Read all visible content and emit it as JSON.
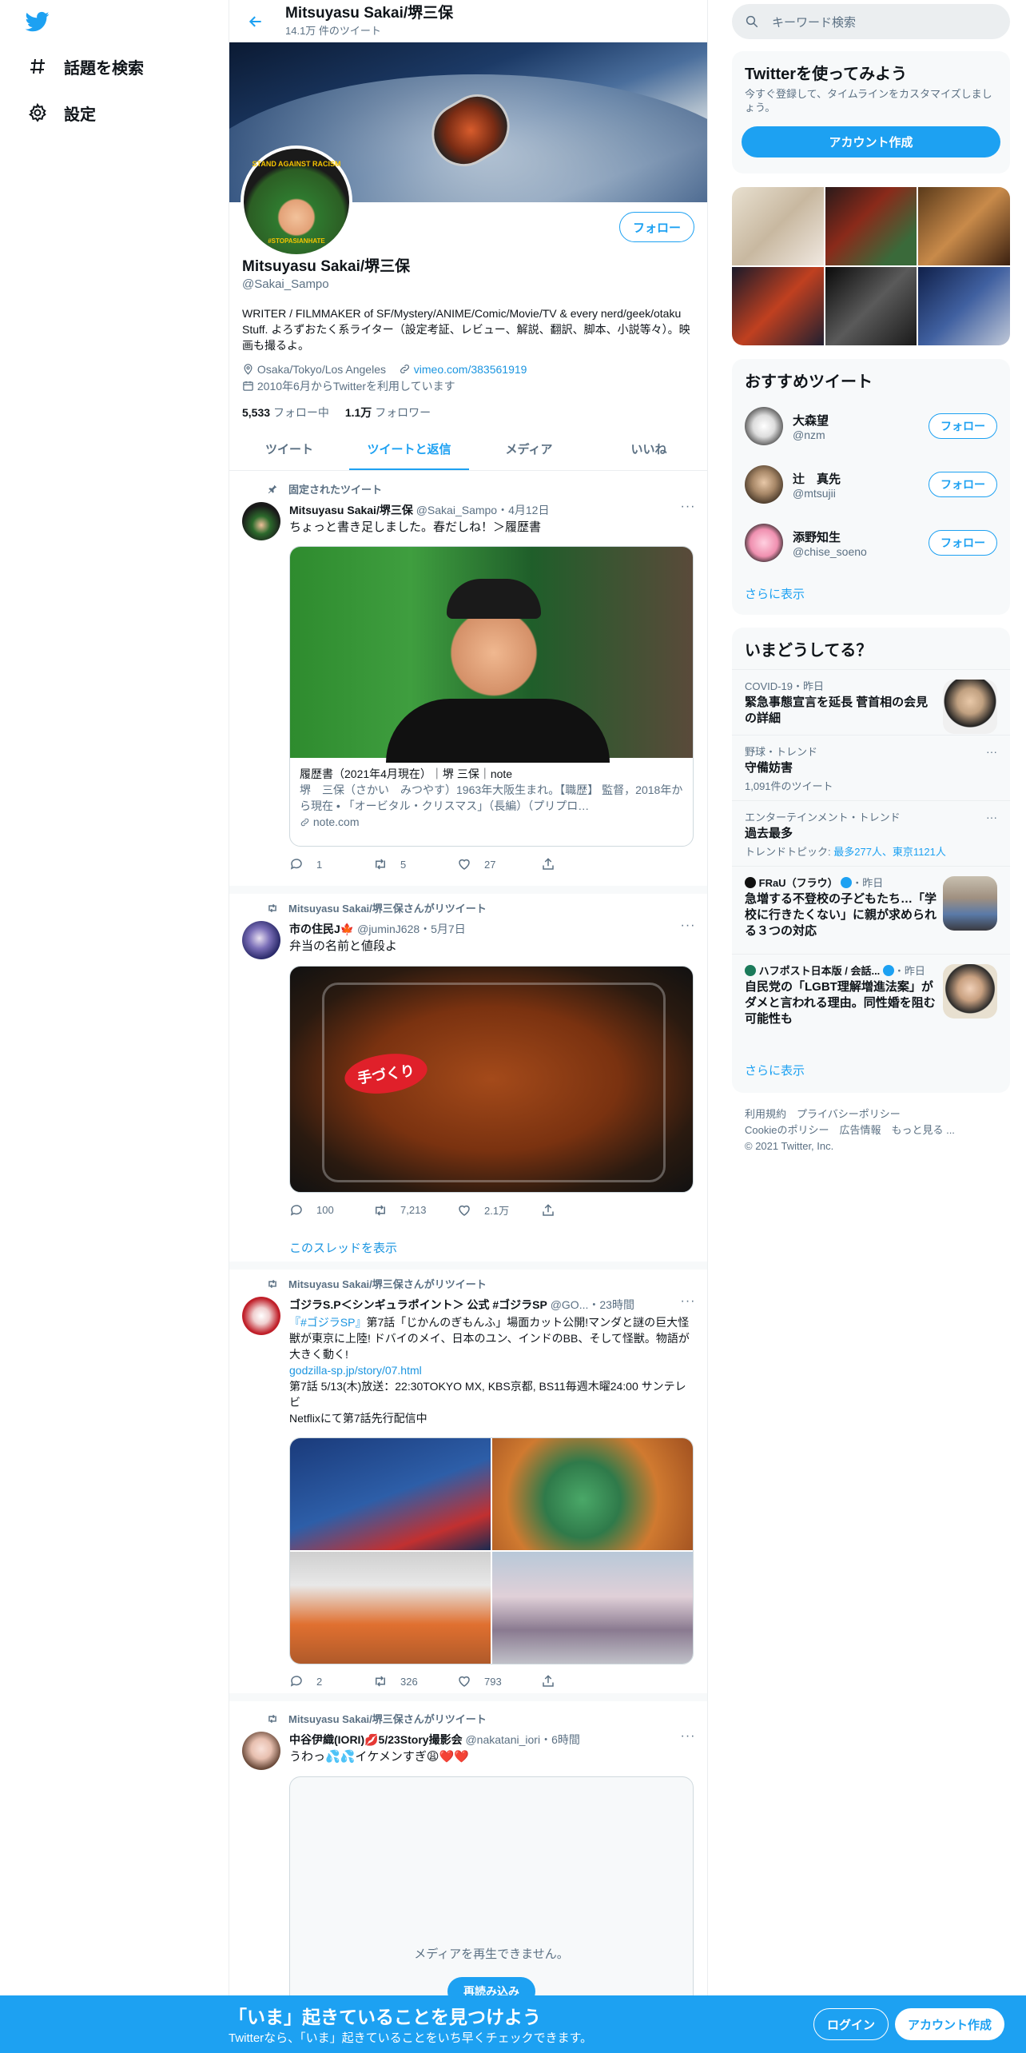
{
  "nav": {
    "explore_label": "話題を検索",
    "settings_label": "設定"
  },
  "header": {
    "name": "Mitsuyasu Sakai/堺三保",
    "tweet_count": "14.1万 件のツイート"
  },
  "profile": {
    "avatar_text_top": "STAND AGAINST RACISM",
    "avatar_text_bottom": "#STOPASIANHATE",
    "follow_label": "フォロー",
    "name": "Mitsuyasu Sakai/堺三保",
    "handle": "@Sakai_Sampo",
    "bio": "WRITER / FILMMAKER of SF/Mystery/ANIME/Comic/Movie/TV & every nerd/geek/otaku Stuff. よろずおたく系ライター（設定考証、レビュー、解説、翻訳、脚本、小説等々）。映画も撮るよ。",
    "location": "Osaka/Tokyo/Los Angeles",
    "url": "vimeo.com/383561919",
    "joined": "2010年6月からTwitterを利用しています",
    "following_count": "5,533",
    "following_label": "フォロー中",
    "followers_count": "1.1万",
    "followers_label": "フォロワー"
  },
  "tabs": [
    "ツイート",
    "ツイートと返信",
    "メディア",
    "いいね"
  ],
  "active_tab": 1,
  "tweets": [
    {
      "context": "固定されたツイート",
      "author": "Mitsuyasu Sakai/堺三保",
      "handle": "@Sakai_Sampo",
      "time": "・4月12日",
      "text": "ちょっと書き足しました。春だしね！＞履歴書",
      "card_title": "履歴書（2021年4月現在）｜堺 三保｜note",
      "card_desc": "堺　三保（さかい　みつやす）1963年大阪生まれ。【職歴】 監督，2018年から現在 • 「オービタル・クリスマス」（長編）（プリプロ…",
      "card_domain": "note.com",
      "replies": "1",
      "retweets": "5",
      "likes": "27"
    },
    {
      "context": "Mitsuyasu Sakai/堺三保さんがリツイート",
      "author": "市の住民J🍁",
      "handle": "@juminJ628",
      "time": "・5月7日",
      "text": "弁当の名前と値段よ",
      "media_label": "手づくり",
      "replies": "100",
      "retweets": "7,213",
      "likes": "2.1万",
      "thread_link": "このスレッドを表示"
    },
    {
      "context": "Mitsuyasu Sakai/堺三保さんがリツイート",
      "author": "ゴジラS.P＜シンギュラポイント＞ 公式 #ゴジラSP",
      "handle": "@GO...",
      "time": "・23時間",
      "hashtag": "『#ゴジラSP』",
      "text": "第7話「じかんのぎもんふ」場面カット公開!マンダと謎の巨大怪獣が東京に上陸! ドバイのメイ、日本のユン、インドのBB、そして怪獣。物語が大きく動く!",
      "link": "godzilla-sp.jp/story/07.html",
      "text2": "第7話 5/13(木)放送：22:30TOKYO MX, KBS京都, BS11毎週木曜24:00 サンテレビ",
      "text3": "Netflixにて第7話先行配信中",
      "replies": "2",
      "retweets": "326",
      "likes": "793"
    },
    {
      "context": "Mitsuyasu Sakai/堺三保さんがリツイート",
      "author": "中谷伊織(IORI)💋5/23Story撮影会",
      "handle": "@nakatani_iori",
      "time": "・6時間",
      "text": "うわっ💦💦イケメンすぎ😩❤️❤️",
      "media_error": "メディアを再生できません。",
      "reload_label": "再読み込み"
    }
  ],
  "right": {
    "search_placeholder": "キーワード検索",
    "signup_title": "Twitterを使ってみよう",
    "signup_desc": "今すぐ登録して、タイムラインをカスタマイズしましょう。",
    "signup_button": "アカウント作成",
    "suggest_title": "おすすめツイート",
    "suggestions": [
      {
        "name": "大森望",
        "handle": "@nzm",
        "button": "フォロー"
      },
      {
        "name": "辻　真先",
        "handle": "@mtsujii",
        "button": "フォロー"
      },
      {
        "name": "添野知生",
        "handle": "@chise_soeno",
        "button": "フォロー"
      }
    ],
    "show_more": "さらに表示",
    "trends_title": "いまどうしてる？",
    "trends": [
      {
        "context": "COVID-19・昨日",
        "title": "緊急事態宣言を延長 菅首相の会見の詳細"
      },
      {
        "context": "野球・トレンド",
        "title": "守備妨害",
        "count": "1,091件のツイート"
      },
      {
        "context": "エンターテインメント・トレンド",
        "title": "過去最多",
        "count": "トレンドトピック: ",
        "count_links": "最多277人、東京1121人"
      },
      {
        "context": "FRaU（フラウ）",
        "context_time": "・昨日",
        "title": "急増する不登校の子どもたち…「学校に行きたくない」に親が求められる３つの対応"
      },
      {
        "context": "ハフポスト日本版 / 会話...",
        "context_time": "・昨日",
        "title": "自民党の「LGBT理解増進法案」がダメと言われる理由。同性婚を阻む可能性も"
      }
    ],
    "footer_line1": "利用規約　プライバシーポリシー",
    "footer_line2": "Cookieのポリシー　広告情報　もっと見る ...",
    "footer_line3": "© 2021 Twitter, Inc."
  },
  "bottombar": {
    "title": "「いま」起きていることを見つけよう",
    "subtitle": "Twitterなら、「いま」起きていることをいち早くチェックできます。",
    "login": "ログイン",
    "signup": "アカウント作成"
  },
  "colors": {
    "accent": "#1da1f2",
    "text": "#0f1419",
    "secondary": "#5b7083"
  }
}
